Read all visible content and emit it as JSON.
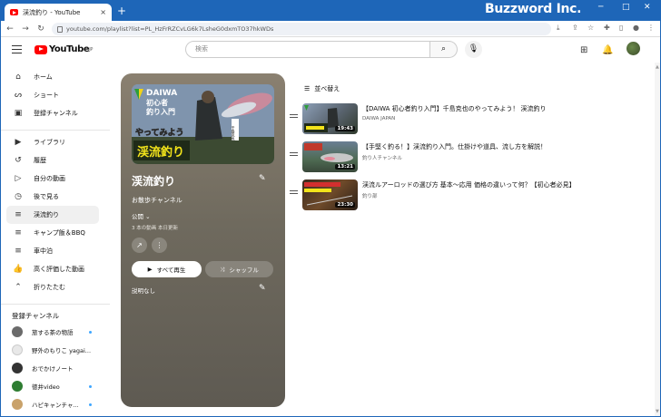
{
  "browser": {
    "tab_title": "渓流釣り - YouTube",
    "tab_close": "×",
    "new_tab": "+",
    "brand": "Buzzword Inc.",
    "url": "youtube.com/playlist?list=PL_HzFrRZCvLG6k7LsheG0dxmTO37hkWDs",
    "minimize": "─",
    "maximize": "□",
    "close": "✕"
  },
  "header": {
    "logo_text": "YouTube",
    "logo_sup": "JP",
    "search_placeholder": "検索",
    "search_icon": "⌕",
    "mic_icon": "🎙"
  },
  "sidebar": {
    "items": [
      {
        "label": "ホーム",
        "icon": "⌂"
      },
      {
        "label": "ショート",
        "icon": "ᔕ"
      },
      {
        "label": "登録チャンネル",
        "icon": "▣"
      },
      {
        "label": "ライブラリ",
        "icon": "▶"
      },
      {
        "label": "履歴",
        "icon": "↺"
      },
      {
        "label": "自分の動画",
        "icon": "▷"
      },
      {
        "label": "後で見る",
        "icon": "◷"
      },
      {
        "label": "渓流釣り",
        "icon": "≡"
      },
      {
        "label": "キャンプ飯＆BBQ",
        "icon": "≡"
      },
      {
        "label": "車中泊",
        "icon": "≡"
      },
      {
        "label": "高く評価した動画",
        "icon": "👍"
      },
      {
        "label": "折りたたむ",
        "icon": "⌃"
      }
    ],
    "subscriptions_heading": "登録チャンネル",
    "channels": [
      {
        "label": "旅する茶の物語",
        "color": "#6b6b6b",
        "dot": true
      },
      {
        "label": "野外のもりこ yagai...",
        "color": "#e8e8e8",
        "dot": false
      },
      {
        "label": "おでかけノート",
        "color": "#333333",
        "dot": false
      },
      {
        "label": "徳井video",
        "color": "#2e7d32",
        "dot": true
      },
      {
        "label": "ハピキャンチャ...",
        "color": "#c9a26b",
        "dot": true
      }
    ]
  },
  "playlist": {
    "title": "渓流釣り",
    "owner": "お散歩チャンネル",
    "visibility": "公開",
    "meta": "3 本の動画  本日更新",
    "play_all": "すべて再生",
    "shuffle": "シャッフル",
    "description": "説明なし",
    "thumb_text": {
      "brand": "DAIWA",
      "line1": "初心者",
      "line2": "釣り入門",
      "line3": "やってみよう",
      "line4": "渓流釣り",
      "badge": "干島克也"
    }
  },
  "list": {
    "sort_label": "並べ替え",
    "videos": [
      {
        "title": "【DAIWA 初心者釣り入門】千島克也のやってみよう！ 渓流釣り",
        "channel": "DAIWA JAPAN",
        "duration": "19:43"
      },
      {
        "title": "【手堅く釣る！】渓流釣り入門。仕掛けや道具、流し方を解説！",
        "channel": "釣り人チャンネル",
        "duration": "13:21"
      },
      {
        "title": "渓流ルアーロッドの選び方 基本〜応用 価格の違いって何？【初心者必見】",
        "channel": "釣り部",
        "duration": "23:30"
      }
    ]
  }
}
